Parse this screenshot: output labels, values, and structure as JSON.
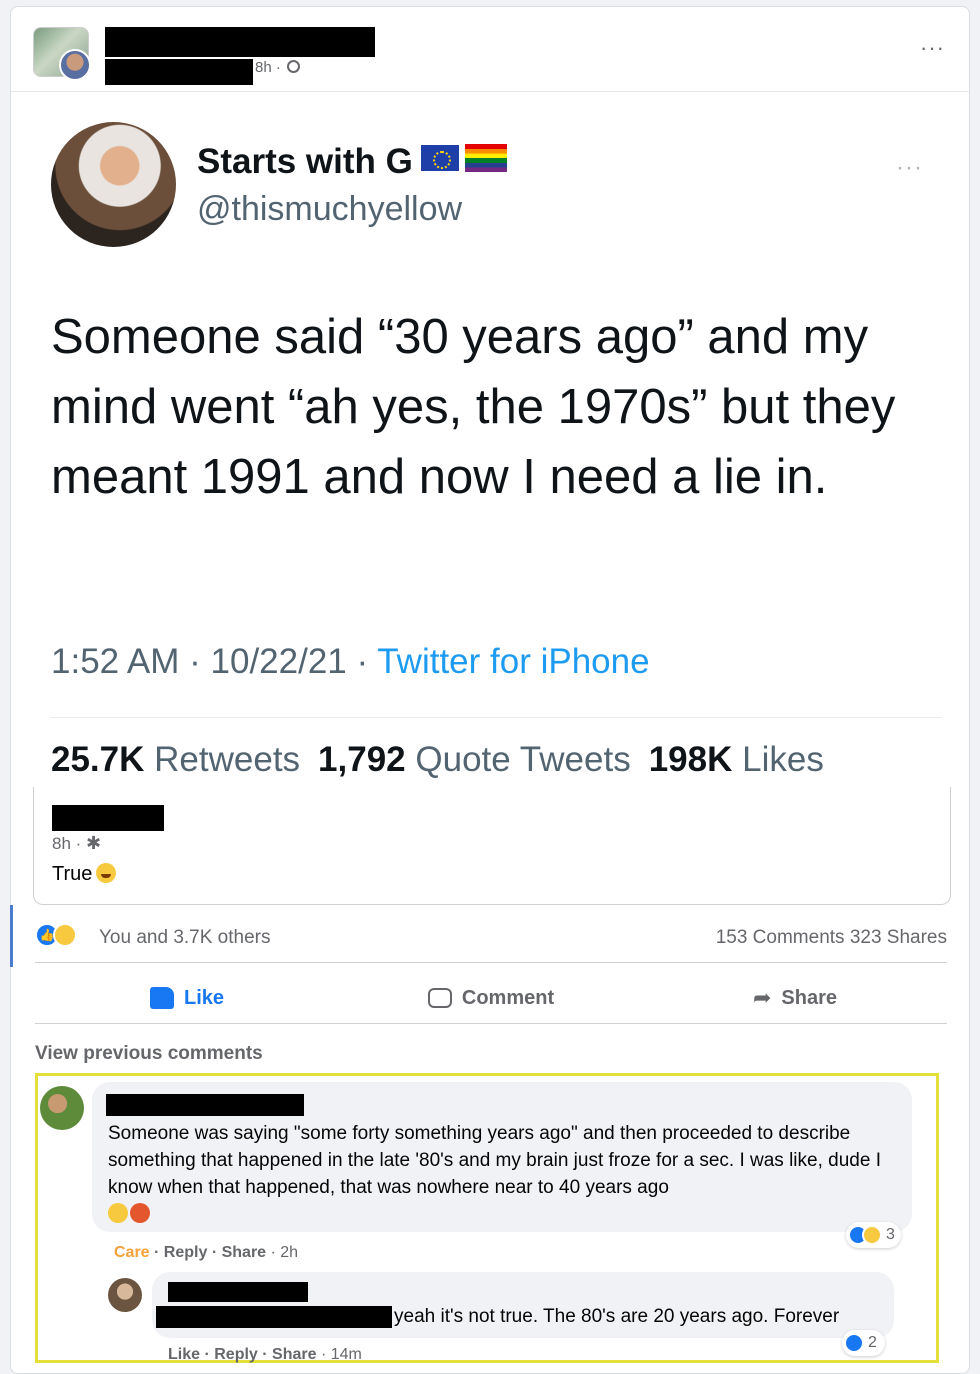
{
  "post": {
    "timestamp": "8h",
    "privacy_icon": "globe-icon",
    "more_icon": "more-options-icon"
  },
  "tweet": {
    "name": "Starts with G",
    "handle": "@thismuchyellow",
    "flags": [
      "eu-flag-icon",
      "rainbow-flag-icon"
    ],
    "text": "Someone said “30 years ago” and my mind went “ah yes, the 1970s” but they meant 1991 and now I need a lie in.",
    "time": "1:52 AM · 10/22/21 · ",
    "source": "Twitter for iPhone",
    "stats": {
      "retweets_count": "25.7K",
      "retweets_label": "Retweets",
      "quotes_count": "1,792",
      "quotes_label": "Quote Tweets",
      "likes_count": "198K",
      "likes_label": "Likes"
    }
  },
  "caption": {
    "timestamp": "8h · ",
    "text": "True"
  },
  "reactions": {
    "summary": "You and 3.7K others",
    "counts": "153 Comments  323 Shares"
  },
  "actions": {
    "like": "Like",
    "comment": "Comment",
    "share": "Share"
  },
  "view_previous": "View previous comments",
  "comments": [
    {
      "text": "Someone was saying \"some forty something years ago\" and then proceeded to describe something that happened in the late '80's and my brain just froze for a sec. I was like, dude I know when that happened, that was nowhere near to 40 years ago",
      "reaction_count": "3",
      "meta_care": "Care",
      "meta_reply": " · Reply · ",
      "meta_share": "Share",
      "meta_time": " · 2h"
    },
    {
      "text": "yeah it's not true. The 80's are 20 years ago. Forever",
      "reaction_count": "2",
      "meta_like": "Like",
      "meta_reply": " · Reply · ",
      "meta_share": "Share",
      "meta_time": " · 14m"
    }
  ],
  "colors": {
    "facebook_blue": "#1877f2",
    "twitter_blue": "#1d9bf0",
    "highlight": "#e6df3a"
  }
}
